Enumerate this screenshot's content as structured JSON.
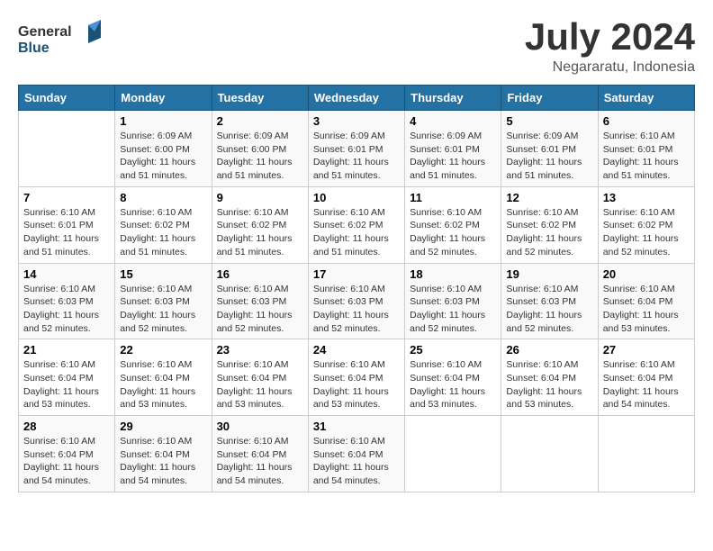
{
  "header": {
    "logo_general": "General",
    "logo_blue": "Blue",
    "month_title": "July 2024",
    "location": "Negararatu, Indonesia"
  },
  "weekdays": [
    "Sunday",
    "Monday",
    "Tuesday",
    "Wednesday",
    "Thursday",
    "Friday",
    "Saturday"
  ],
  "weeks": [
    [
      {
        "day": "",
        "info": ""
      },
      {
        "day": "1",
        "info": "Sunrise: 6:09 AM\nSunset: 6:00 PM\nDaylight: 11 hours\nand 51 minutes."
      },
      {
        "day": "2",
        "info": "Sunrise: 6:09 AM\nSunset: 6:00 PM\nDaylight: 11 hours\nand 51 minutes."
      },
      {
        "day": "3",
        "info": "Sunrise: 6:09 AM\nSunset: 6:01 PM\nDaylight: 11 hours\nand 51 minutes."
      },
      {
        "day": "4",
        "info": "Sunrise: 6:09 AM\nSunset: 6:01 PM\nDaylight: 11 hours\nand 51 minutes."
      },
      {
        "day": "5",
        "info": "Sunrise: 6:09 AM\nSunset: 6:01 PM\nDaylight: 11 hours\nand 51 minutes."
      },
      {
        "day": "6",
        "info": "Sunrise: 6:10 AM\nSunset: 6:01 PM\nDaylight: 11 hours\nand 51 minutes."
      }
    ],
    [
      {
        "day": "7",
        "info": "Sunrise: 6:10 AM\nSunset: 6:01 PM\nDaylight: 11 hours\nand 51 minutes."
      },
      {
        "day": "8",
        "info": "Sunrise: 6:10 AM\nSunset: 6:02 PM\nDaylight: 11 hours\nand 51 minutes."
      },
      {
        "day": "9",
        "info": "Sunrise: 6:10 AM\nSunset: 6:02 PM\nDaylight: 11 hours\nand 51 minutes."
      },
      {
        "day": "10",
        "info": "Sunrise: 6:10 AM\nSunset: 6:02 PM\nDaylight: 11 hours\nand 51 minutes."
      },
      {
        "day": "11",
        "info": "Sunrise: 6:10 AM\nSunset: 6:02 PM\nDaylight: 11 hours\nand 52 minutes."
      },
      {
        "day": "12",
        "info": "Sunrise: 6:10 AM\nSunset: 6:02 PM\nDaylight: 11 hours\nand 52 minutes."
      },
      {
        "day": "13",
        "info": "Sunrise: 6:10 AM\nSunset: 6:02 PM\nDaylight: 11 hours\nand 52 minutes."
      }
    ],
    [
      {
        "day": "14",
        "info": "Sunrise: 6:10 AM\nSunset: 6:03 PM\nDaylight: 11 hours\nand 52 minutes."
      },
      {
        "day": "15",
        "info": "Sunrise: 6:10 AM\nSunset: 6:03 PM\nDaylight: 11 hours\nand 52 minutes."
      },
      {
        "day": "16",
        "info": "Sunrise: 6:10 AM\nSunset: 6:03 PM\nDaylight: 11 hours\nand 52 minutes."
      },
      {
        "day": "17",
        "info": "Sunrise: 6:10 AM\nSunset: 6:03 PM\nDaylight: 11 hours\nand 52 minutes."
      },
      {
        "day": "18",
        "info": "Sunrise: 6:10 AM\nSunset: 6:03 PM\nDaylight: 11 hours\nand 52 minutes."
      },
      {
        "day": "19",
        "info": "Sunrise: 6:10 AM\nSunset: 6:03 PM\nDaylight: 11 hours\nand 52 minutes."
      },
      {
        "day": "20",
        "info": "Sunrise: 6:10 AM\nSunset: 6:04 PM\nDaylight: 11 hours\nand 53 minutes."
      }
    ],
    [
      {
        "day": "21",
        "info": "Sunrise: 6:10 AM\nSunset: 6:04 PM\nDaylight: 11 hours\nand 53 minutes."
      },
      {
        "day": "22",
        "info": "Sunrise: 6:10 AM\nSunset: 6:04 PM\nDaylight: 11 hours\nand 53 minutes."
      },
      {
        "day": "23",
        "info": "Sunrise: 6:10 AM\nSunset: 6:04 PM\nDaylight: 11 hours\nand 53 minutes."
      },
      {
        "day": "24",
        "info": "Sunrise: 6:10 AM\nSunset: 6:04 PM\nDaylight: 11 hours\nand 53 minutes."
      },
      {
        "day": "25",
        "info": "Sunrise: 6:10 AM\nSunset: 6:04 PM\nDaylight: 11 hours\nand 53 minutes."
      },
      {
        "day": "26",
        "info": "Sunrise: 6:10 AM\nSunset: 6:04 PM\nDaylight: 11 hours\nand 53 minutes."
      },
      {
        "day": "27",
        "info": "Sunrise: 6:10 AM\nSunset: 6:04 PM\nDaylight: 11 hours\nand 54 minutes."
      }
    ],
    [
      {
        "day": "28",
        "info": "Sunrise: 6:10 AM\nSunset: 6:04 PM\nDaylight: 11 hours\nand 54 minutes."
      },
      {
        "day": "29",
        "info": "Sunrise: 6:10 AM\nSunset: 6:04 PM\nDaylight: 11 hours\nand 54 minutes."
      },
      {
        "day": "30",
        "info": "Sunrise: 6:10 AM\nSunset: 6:04 PM\nDaylight: 11 hours\nand 54 minutes."
      },
      {
        "day": "31",
        "info": "Sunrise: 6:10 AM\nSunset: 6:04 PM\nDaylight: 11 hours\nand 54 minutes."
      },
      {
        "day": "",
        "info": ""
      },
      {
        "day": "",
        "info": ""
      },
      {
        "day": "",
        "info": ""
      }
    ]
  ]
}
